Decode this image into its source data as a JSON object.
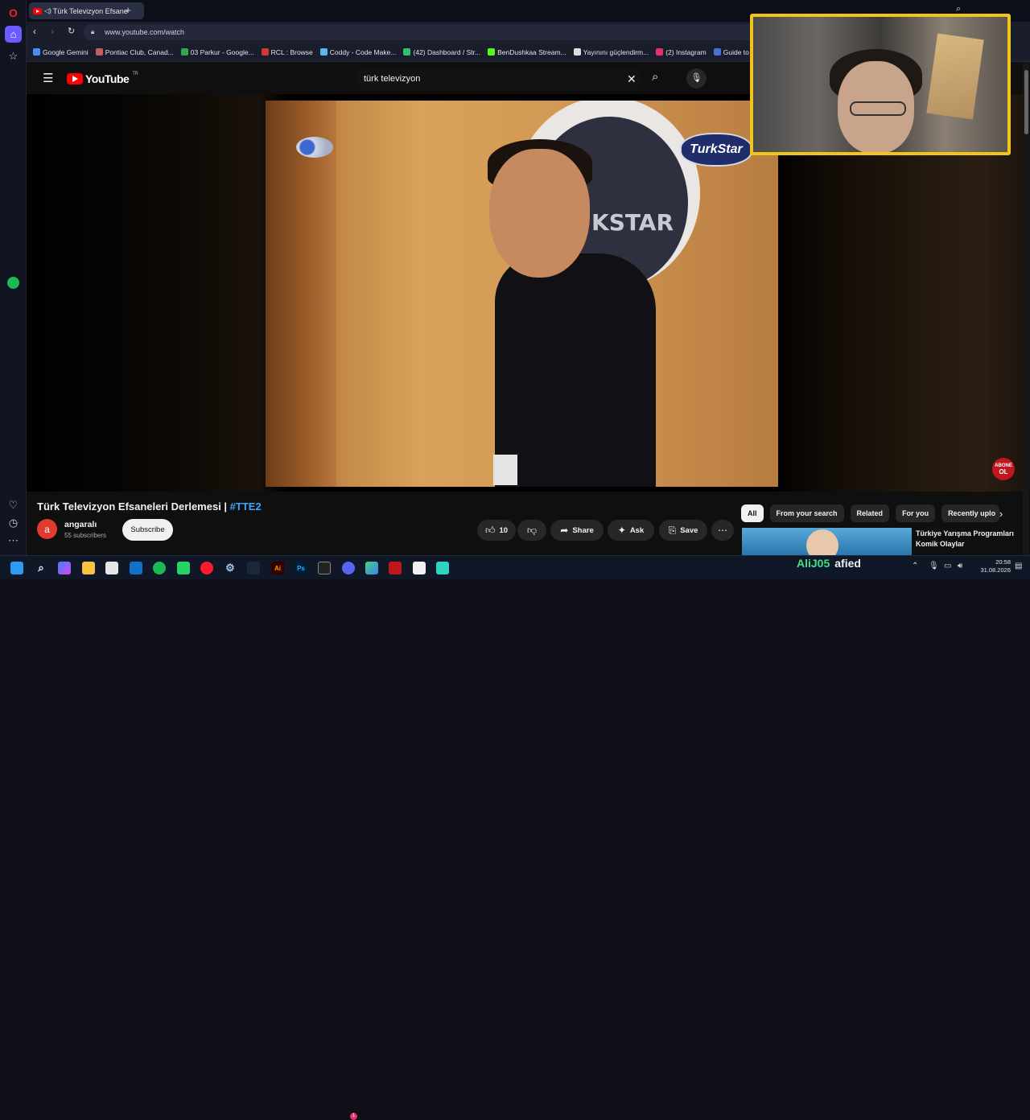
{
  "browser": {
    "tab": {
      "title": "Türk Televizyon Efsane"
    },
    "address": {
      "url": "www.youtube.com/watch"
    },
    "corner_label": "AI",
    "bookmarks": [
      {
        "label": "Google Gemini",
        "color": "#4d8cf5"
      },
      {
        "label": "Pontiac Club, Canad...",
        "color": "#c06060"
      },
      {
        "label": "03 Parkur - Google...",
        "color": "#2fa84f"
      },
      {
        "label": "RCL : Browse",
        "color": "#d03a2c"
      },
      {
        "label": "Coddy - Code Make...",
        "color": "#5ab8f0"
      },
      {
        "label": "(42) Dashboard / Str...",
        "color": "#2fbf71"
      },
      {
        "label": "BenDushkaa Stream...",
        "color": "#53fc18"
      },
      {
        "label": "Yayınını güçlendirm...",
        "color": "#dddddd"
      },
      {
        "label": "(2) Instagram",
        "color": "#e1306c"
      },
      {
        "label": "Guide to Aerodyna...",
        "color": "#4a6fd6"
      }
    ]
  },
  "youtube": {
    "logo": "YouTube",
    "country": "TR",
    "search_query": "türk televizyon",
    "video": {
      "frame_logo_text": "KSTAR",
      "frame_badge": "TurkStar",
      "abone": [
        "ABONE",
        "OL"
      ]
    },
    "title_main": "Türk Televizyon Efsaneleri Derlemesi | ",
    "title_tag": "#TTE2",
    "channel": {
      "avatar_letter": "a",
      "name": "angaralı",
      "subscribers": "55 subscribers",
      "subscribe_label": "Subscribe"
    },
    "actions": {
      "likes": "10",
      "share": "Share",
      "ask": "Ask",
      "save": "Save"
    },
    "chips": [
      "All",
      "From your search",
      "Related",
      "For you",
      "Recently uplo"
    ],
    "recommended": {
      "title": "Türkiye Yarışma Programları Komik Olaylar"
    }
  },
  "stream_overlay": {
    "user1": "AliJ05",
    "user2": "afied"
  },
  "taskbar": {
    "time": "20:58",
    "date": "31.08.2026",
    "badge_count": "1"
  }
}
